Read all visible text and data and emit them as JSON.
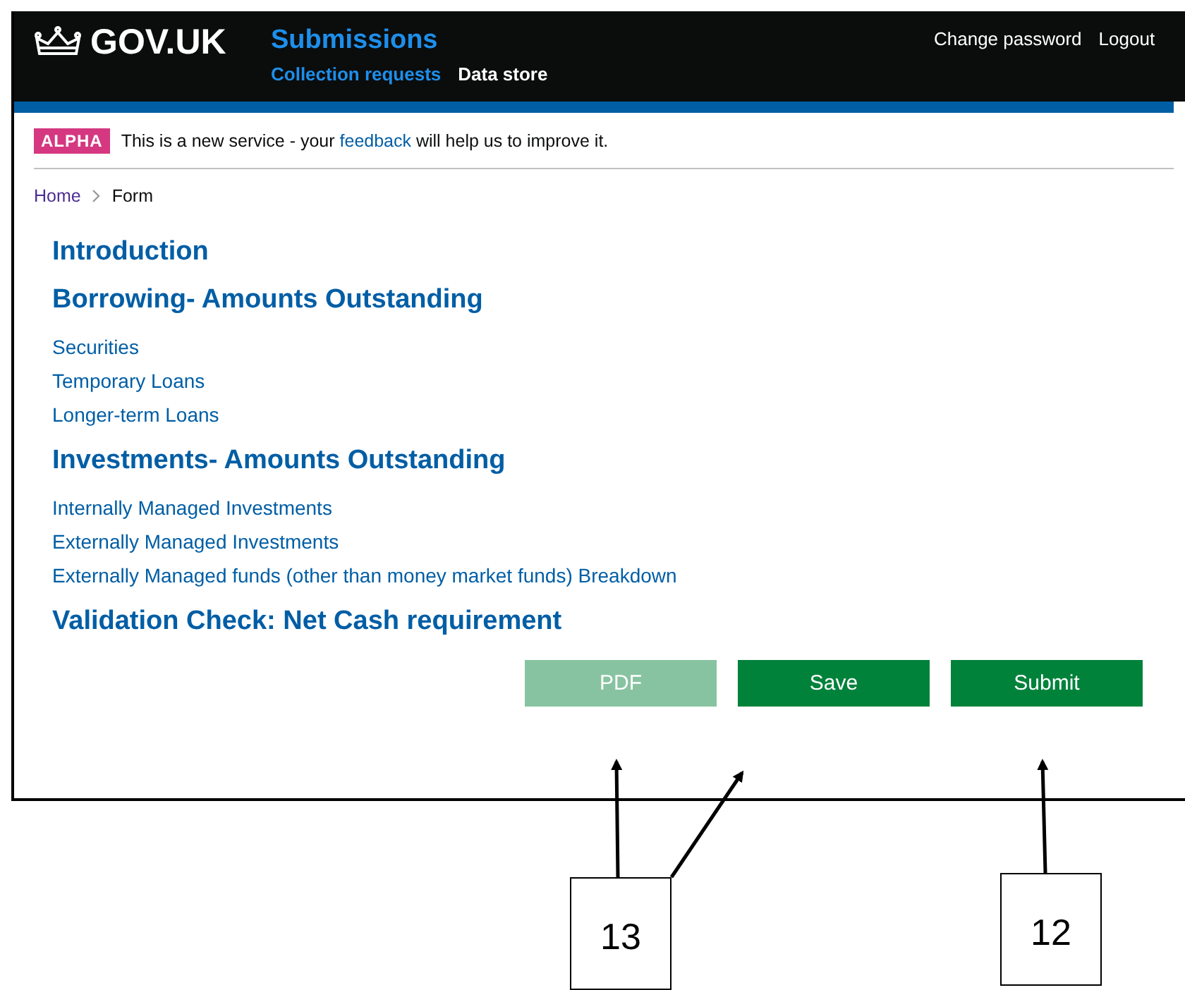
{
  "header": {
    "logo": "GOV.UK",
    "service": "Submissions",
    "nav": [
      {
        "label": "Collection requests",
        "selected": true
      },
      {
        "label": "Data store",
        "selected": false
      }
    ],
    "account_links": [
      "Change password",
      "Logout"
    ]
  },
  "phase_banner": {
    "tag": "ALPHA",
    "text_before": "This is a new service - your ",
    "link": "feedback",
    "text_after": " will help us to improve it."
  },
  "breadcrumbs": [
    {
      "label": "Home",
      "current": false
    },
    {
      "label": "Form",
      "current": true
    }
  ],
  "sections": [
    {
      "kind": "heading",
      "text": "Introduction"
    },
    {
      "kind": "heading",
      "text": "Borrowing- Amounts Outstanding"
    },
    {
      "kind": "link",
      "text": "Securities"
    },
    {
      "kind": "link",
      "text": "Temporary Loans"
    },
    {
      "kind": "link",
      "text": "Longer-term Loans"
    },
    {
      "kind": "heading",
      "text": "Investments- Amounts Outstanding"
    },
    {
      "kind": "link",
      "text": "Internally Managed Investments"
    },
    {
      "kind": "link",
      "text": "Externally Managed Investments"
    },
    {
      "kind": "link",
      "text": "Externally Managed funds (other than money market funds) Breakdown"
    },
    {
      "kind": "heading",
      "text": "Validation Check: Net Cash requirement"
    }
  ],
  "buttons": [
    {
      "label": "PDF",
      "disabled": true
    },
    {
      "label": "Save",
      "disabled": false
    },
    {
      "label": "Submit",
      "disabled": false
    }
  ],
  "callouts": [
    "13",
    "12"
  ]
}
